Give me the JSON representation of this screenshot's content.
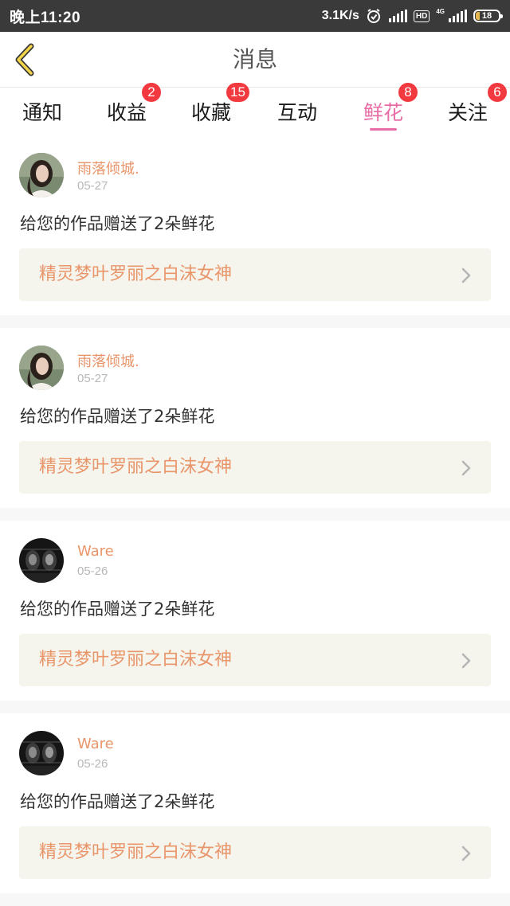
{
  "status_bar": {
    "time": "晚上11:20",
    "network_speed": "3.1K/s",
    "hd_label": "HD",
    "network_type": "4G",
    "battery": "18",
    "battery_level": 0.18
  },
  "header": {
    "title": "消息"
  },
  "tabs": [
    {
      "label": "通知",
      "badge": ""
    },
    {
      "label": "收益",
      "badge": "2"
    },
    {
      "label": "收藏",
      "badge": "15"
    },
    {
      "label": "互动",
      "badge": ""
    },
    {
      "label": "鲜花",
      "badge": "8",
      "active": true
    },
    {
      "label": "关注",
      "badge": "6"
    }
  ],
  "messages": [
    {
      "sender": "雨落倾城.",
      "date": "05-27",
      "text": "给您的作品赠送了2朵鲜花",
      "work_title": "精灵梦叶罗丽之白沫女神",
      "avatar": "woman-portrait-avatar"
    },
    {
      "sender": "雨落倾城.",
      "date": "05-27",
      "text": "给您的作品赠送了2朵鲜花",
      "work_title": "精灵梦叶罗丽之白沫女神",
      "avatar": "woman-portrait-avatar"
    },
    {
      "sender": "Ware",
      "date": "05-26",
      "text": "给您的作品赠送了2朵鲜花",
      "work_title": "精灵梦叶罗丽之白沫女神",
      "avatar": "dark-group-avatar"
    },
    {
      "sender": "Ware",
      "date": "05-26",
      "text": "给您的作品赠送了2朵鲜花",
      "work_title": "精灵梦叶罗丽之白沫女神",
      "avatar": "dark-group-avatar"
    }
  ],
  "colors": {
    "accent_pink": "#e86ca5",
    "badge_red": "#f2393f",
    "link_orange": "#e9956a",
    "back_arrow_yellow": "#f2d34c"
  }
}
